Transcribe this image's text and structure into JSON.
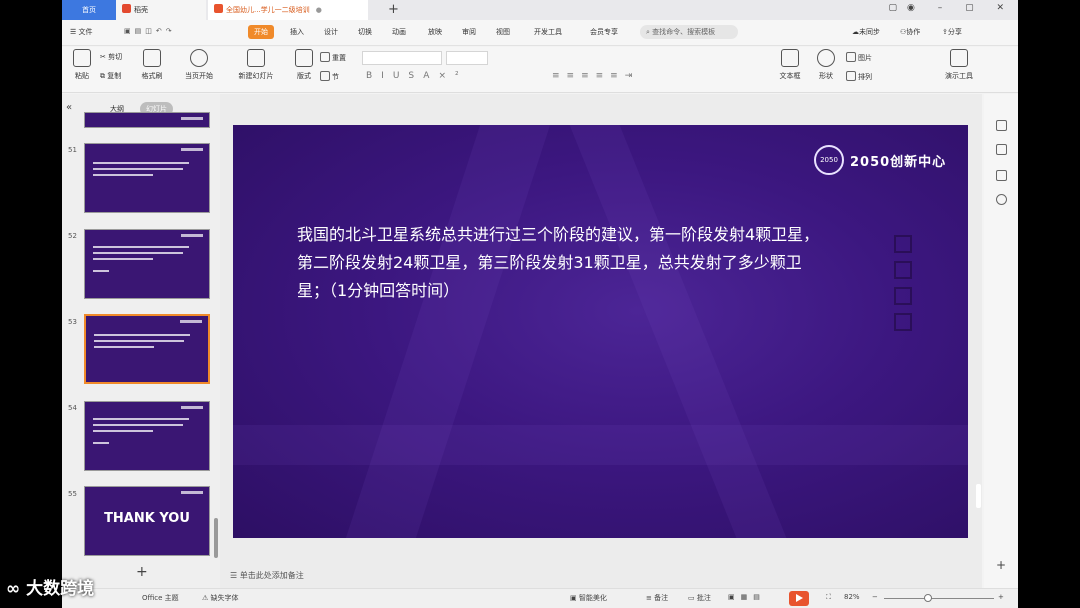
{
  "tabs": {
    "home": "首页",
    "docer": "稻壳",
    "doc": "全国幼儿...学儿一二级培训"
  },
  "menu": {
    "file": "文件",
    "items": [
      "开始",
      "插入",
      "设计",
      "切换",
      "动画",
      "放映",
      "审阅",
      "视图",
      "开发工具",
      "会员专享"
    ],
    "search_placeholder": "查找命令、搜索模板",
    "sync": "未同步",
    "collab": "协作",
    "share": "分享"
  },
  "ribbon": {
    "paste": "粘贴",
    "cut": "剪切",
    "copy": "复制",
    "format_painter": "格式刷",
    "from_current": "当页开始",
    "new_slide": "新建幻灯片",
    "layout": "版式",
    "section": "节",
    "reset": "重置",
    "textbox": "文本框",
    "shape": "形状",
    "image": "图片",
    "arrange": "排列",
    "present_tools": "演示工具"
  },
  "left_panel": {
    "outline_tab": "大纲",
    "slides_tab": "幻灯片",
    "slide_numbers": [
      "51",
      "52",
      "53",
      "54",
      "55"
    ],
    "thank_you": "THANK YOU",
    "add_slide": "+"
  },
  "slide": {
    "logo_text": "2050创新中心",
    "logo_mark": "2050",
    "question": "我国的北斗卫星系统总共进行过三个阶段的建议，第一阶段发射4颗卫星，第二阶段发射24颗卫星，第三阶段发射31颗卫星，总共发射了多少颗卫星；（1分钟回答时间）"
  },
  "notes_placeholder": "单击此处添加备注",
  "statusbar": {
    "theme": "Office 主题",
    "missing_font": "缺失字体",
    "beautify": "智能美化",
    "notes": "备注",
    "comments": "批注",
    "zoom": "82%",
    "zoom_minus": "−",
    "zoom_plus": "+"
  },
  "watermark": "大数跨境",
  "colors": {
    "accent": "#f08a2a",
    "home_tab": "#3d78e0",
    "slide_bg": "#3c1780",
    "play": "#e8542e"
  }
}
